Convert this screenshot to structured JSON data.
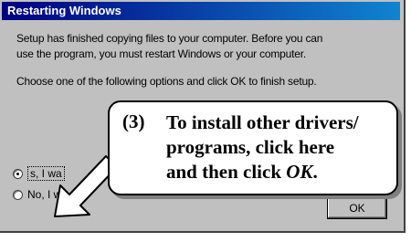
{
  "window": {
    "title": "Restarting Windows"
  },
  "message": {
    "line1": "Setup has finished copying files to your computer.  Before you can",
    "line2": "use the program, you must restart Windows or your computer.",
    "instruction": "Choose one of the following options and click OK to finish setup."
  },
  "options": [
    {
      "label": "Yes, I want to restart my computer now.",
      "visible_label": "s, I wa",
      "selected": true
    },
    {
      "label": "No, I will restart my computer later.",
      "visible_label": "No, I wi",
      "selected": false
    }
  ],
  "ok_button": {
    "label": "OK"
  },
  "callout": {
    "number": "(3)",
    "line1": "To install other drivers/",
    "line2": "programs, click here",
    "line3_prefix": "and then click ",
    "line3_emph": "OK",
    "line3_suffix": "."
  },
  "colors": {
    "titlebar_start": "#000080",
    "titlebar_end": "#1084d0",
    "dialog_bg": "#c0c0c0"
  }
}
